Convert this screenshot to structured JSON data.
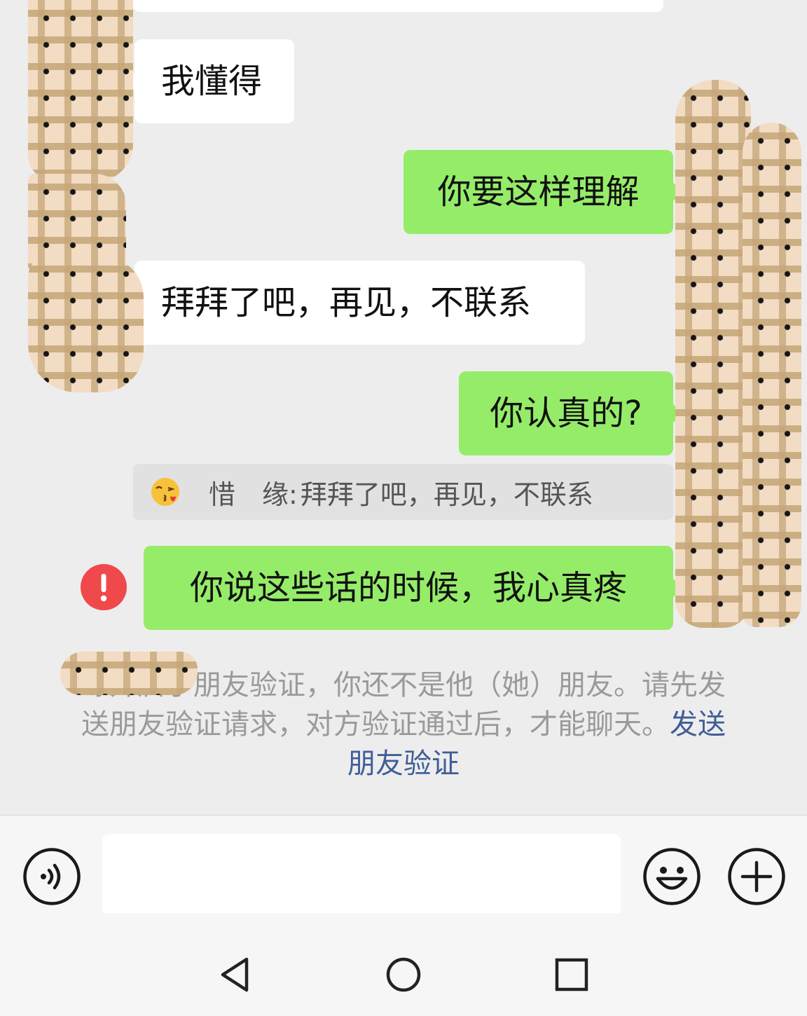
{
  "messages": {
    "incoming_1": "我懂得",
    "outgoing_1": "你要这样理解",
    "incoming_2": "拜拜了吧，再见，不联系",
    "outgoing_2": "你认真的?",
    "quote": {
      "sender": "惜　缘:",
      "text": "拜拜了吧，再见，不联系",
      "emoji": "kissing-heart-emoji"
    },
    "outgoing_3": "你说这些话的时候，我心真疼",
    "failed_icon": "exclamation-icon"
  },
  "system_notice": {
    "text": "缘开启了朋友验证，你还不是他（她）朋友。请先发送朋友验证请求，对方验证通过后，才能聊天。",
    "link": "发送朋友验证"
  },
  "input_bar": {
    "voice_icon": "voice-icon",
    "text_value": "",
    "emoji_icon": "smiley-icon",
    "plus_icon": "plus-icon"
  },
  "nav_bar": {
    "back_icon": "back-triangle-icon",
    "home_icon": "home-circle-icon",
    "recents_icon": "recents-square-icon"
  },
  "colors": {
    "background": "#ededed",
    "outgoing_bubble": "#95ec69",
    "incoming_bubble": "#ffffff",
    "failed": "#f0494b",
    "link": "#3f5e96"
  }
}
